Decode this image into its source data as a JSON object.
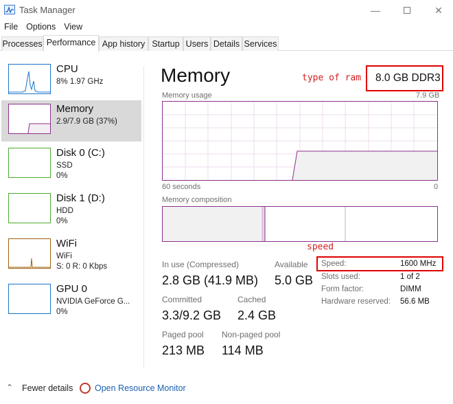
{
  "window": {
    "title": "Task Manager",
    "minimize": "—",
    "close": "✕"
  },
  "menu": [
    "File",
    "Options",
    "View"
  ],
  "tabs": [
    "Processes",
    "Performance",
    "App history",
    "Startup",
    "Users",
    "Details",
    "Services"
  ],
  "active_tab": "Performance",
  "sidebar": [
    {
      "name": "CPU",
      "lines": [
        "8% 1.97 GHz"
      ],
      "color": "#1a73c8"
    },
    {
      "name": "Memory",
      "lines": [
        "2.9/7.9 GB (37%)"
      ],
      "color": "#8b2f8b",
      "selected": true
    },
    {
      "name": "Disk 0 (C:)",
      "lines": [
        "SSD",
        "0%"
      ],
      "color": "#4caa2d"
    },
    {
      "name": "Disk 1 (D:)",
      "lines": [
        "HDD",
        "0%"
      ],
      "color": "#4caa2d"
    },
    {
      "name": "WiFi",
      "lines": [
        "WiFi",
        "S: 0 R: 0 Kbps"
      ],
      "color": "#a0620f"
    },
    {
      "name": "GPU 0",
      "lines": [
        "NVIDIA GeForce G...",
        "0%"
      ],
      "color": "#1a73c8"
    }
  ],
  "main": {
    "title": "Memory",
    "type_annotation": "type of ram",
    "ram_type": "8.0 GB DDR3",
    "usage_label": "Memory usage",
    "usage_max": "7.9 GB",
    "axis_left": "60 seconds",
    "axis_right": "0",
    "composition_label": "Memory composition",
    "speed_annotation": "speed",
    "accent_color": "#8b2f8b"
  },
  "stats": {
    "in_use_label": "In use (Compressed)",
    "in_use_value": "2.8 GB (41.9 MB)",
    "available_label": "Available",
    "available_value": "5.0 GB",
    "committed_label": "Committed",
    "committed_value": "3.3/9.2 GB",
    "cached_label": "Cached",
    "cached_value": "2.4 GB",
    "paged_label": "Paged pool",
    "paged_value": "213 MB",
    "nonpaged_label": "Non-paged pool",
    "nonpaged_value": "114 MB"
  },
  "details": [
    {
      "label": "Speed:",
      "value": "1600 MHz"
    },
    {
      "label": "Slots used:",
      "value": "1 of 2"
    },
    {
      "label": "Form factor:",
      "value": "DIMM"
    },
    {
      "label": "Hardware reserved:",
      "value": "56.6 MB"
    }
  ],
  "footer": {
    "fewer_details": "Fewer details",
    "resource_monitor": "Open Resource Monitor"
  }
}
